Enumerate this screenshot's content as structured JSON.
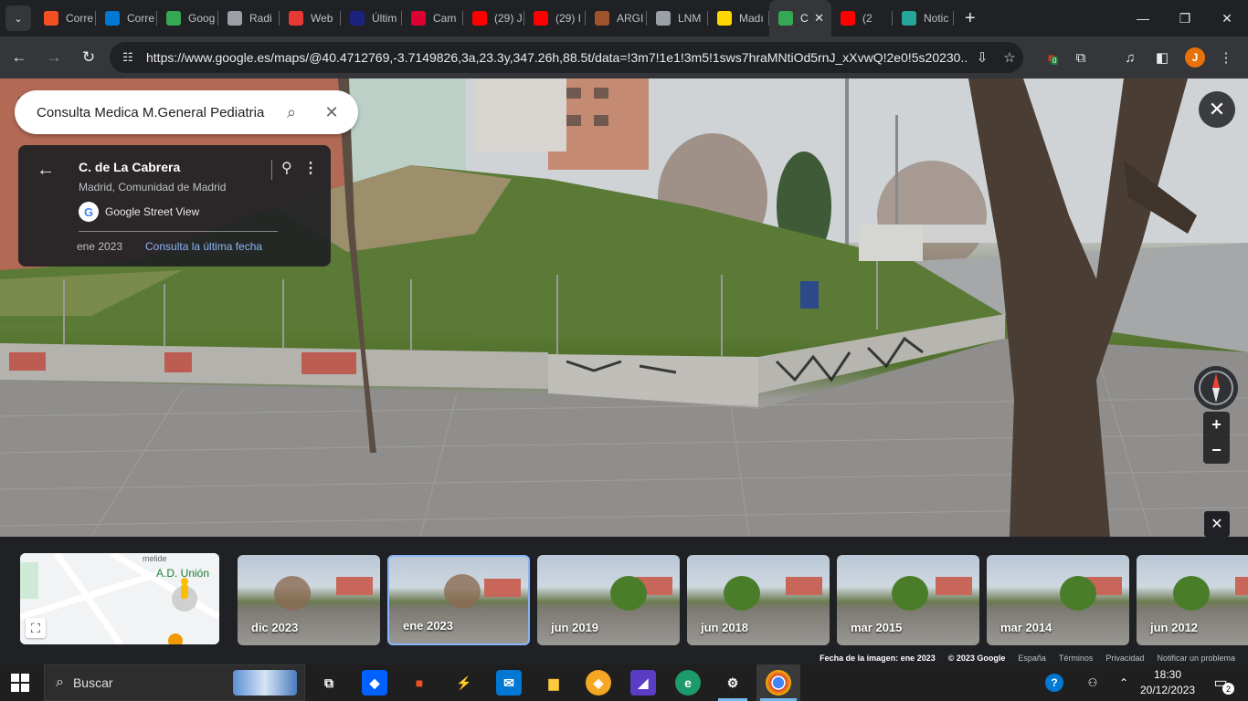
{
  "browser": {
    "tabs": [
      {
        "label": "Corre",
        "icon": "microsoft-icon",
        "color": "#f25022"
      },
      {
        "label": "Corre",
        "icon": "outlook-icon",
        "color": "#0078d4"
      },
      {
        "label": "Goog",
        "icon": "google-maps-icon",
        "color": "#34a853"
      },
      {
        "label": "Radi",
        "icon": "radio-icon",
        "color": "#9aa0a6"
      },
      {
        "label": "Web",
        "icon": "web-icon",
        "color": "#e53935"
      },
      {
        "label": "Últim",
        "icon": "v-icon",
        "color": "#1a237e"
      },
      {
        "label": "Cam",
        "icon": "angular-icon",
        "color": "#dd0031"
      },
      {
        "label": "(29) J",
        "icon": "youtube-icon",
        "color": "#ff0000"
      },
      {
        "label": "(29) I",
        "icon": "youtube-icon",
        "color": "#ff0000"
      },
      {
        "label": "ARGI",
        "icon": "bookmark-icon",
        "color": "#a0522d"
      },
      {
        "label": "LNM",
        "icon": "globe-icon",
        "color": "#9aa0a6"
      },
      {
        "label": "Madı",
        "icon": "u-icon",
        "color": "#ffd600"
      },
      {
        "label": "C",
        "icon": "google-maps-icon",
        "color": "#34a853",
        "active": true
      },
      {
        "label": "(2",
        "icon": "youtube-icon",
        "color": "#ff0000"
      },
      {
        "label": "Notic",
        "icon": "news-icon",
        "color": "#26a69a"
      }
    ],
    "url": "https://www.google.es/maps/@40.4712769,-3.7149826,3a,23.3y,347.26h,88.5t/data=!3m7!1e1!3m5!1sws7hraMNtiOd5rnJ_xXvwQ!2e0!5s20230...",
    "avatar_letter": "J",
    "extension_badge": "0"
  },
  "maps": {
    "search_query": "Consulta Medica M.General Pediatria",
    "location_title": "C. de La Cabrera",
    "location_sub": "Madrid, Comunidad de Madrid",
    "provider": "Google Street View",
    "capture_date": "ene 2023",
    "latest_link": "Consulta la última fecha",
    "minimap_label": "A.D. Unión",
    "minimap_street": "melide",
    "timeline": [
      {
        "label": "dic 2023",
        "selected": false
      },
      {
        "label": "ene 2023",
        "selected": true
      },
      {
        "label": "jun 2019",
        "selected": false
      },
      {
        "label": "jun 2018",
        "selected": false
      },
      {
        "label": "mar 2015",
        "selected": false
      },
      {
        "label": "mar 2014",
        "selected": false
      },
      {
        "label": "jun 2012",
        "selected": false
      }
    ],
    "footer": {
      "image_date": "Fecha de la imagen: ene 2023",
      "copyright": "© 2023 Google",
      "country": "España",
      "terms": "Términos",
      "privacy": "Privacidad",
      "report": "Notificar un problema"
    }
  },
  "taskbar": {
    "search_placeholder": "Buscar",
    "time": "18:30",
    "date": "20/12/2023",
    "notif_count": "2"
  }
}
